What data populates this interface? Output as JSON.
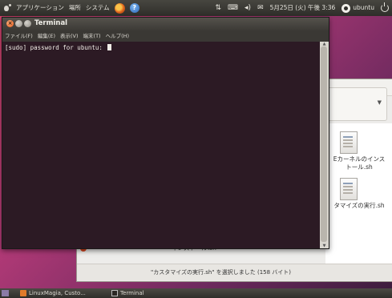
{
  "top_panel": {
    "menus": [
      "アプリケーション",
      "場所",
      "システム"
    ],
    "datetime": "5月25日 (火) 午後 3:36",
    "user": "ubuntu"
  },
  "terminal": {
    "title": "Terminal",
    "menus": [
      "ファイル(F)",
      "編集(E)",
      "表示(V)",
      "端末(T)",
      "ヘルプ(H)"
    ],
    "prompt_line": "[sudo] password for ubuntu: "
  },
  "file_manager": {
    "files": [
      {
        "label_lines": [
          "Eカーネルのインス",
          "トール.sh"
        ],
        "selected": false
      },
      {
        "label_lines": [
          "タマイズの実行.sh"
        ],
        "selected": true
      }
    ],
    "bottom_file": "インストール.sh",
    "status": "\"カスタマイズの実行.sh\" を選択しました (158 バイト)"
  },
  "taskbar": {
    "tasks": [
      "LinuxMagia, Custo...",
      "Terminal"
    ]
  },
  "colors": {
    "terminal_bg": "#2c1a24",
    "panel": "#3c3b37",
    "wallpaper": "#b33a77"
  }
}
